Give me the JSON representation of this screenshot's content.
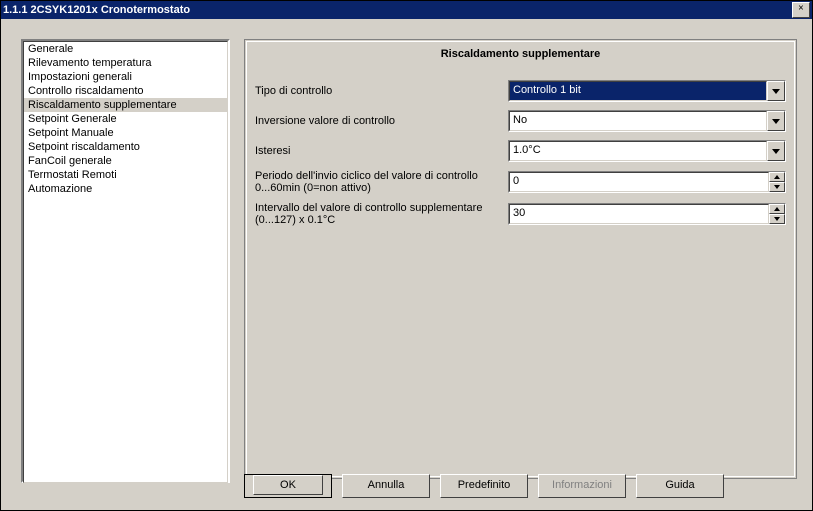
{
  "window": {
    "title": "1.1.1 2CSYK1201x Cronotermostato",
    "close": "×"
  },
  "sidebar": {
    "items": [
      {
        "label": "Generale"
      },
      {
        "label": "Rilevamento temperatura"
      },
      {
        "label": "Impostazioni generali"
      },
      {
        "label": "Controllo riscaldamento"
      },
      {
        "label": "Riscaldamento supplementare",
        "selected": true
      },
      {
        "label": "Setpoint Generale"
      },
      {
        "label": "Setpoint Manuale"
      },
      {
        "label": "Setpoint riscaldamento"
      },
      {
        "label": "FanCoil generale"
      },
      {
        "label": "Termostati Remoti"
      },
      {
        "label": "Automazione"
      }
    ]
  },
  "group": {
    "title": "Riscaldamento supplementare"
  },
  "params": [
    {
      "key": "controlType",
      "label": "Tipo di controllo",
      "kind": "combo",
      "value": "Controllo 1 bit",
      "highlighted": true
    },
    {
      "key": "invert",
      "label": "Inversione valore di controllo",
      "kind": "combo",
      "value": "No"
    },
    {
      "key": "hysteresis",
      "label": "Isteresi",
      "kind": "combo",
      "value": "1.0°C"
    },
    {
      "key": "cyclic",
      "label": "Periodo dell'invio ciclico del valore di controllo 0...60min (0=non attivo)",
      "kind": "spin",
      "value": "0"
    },
    {
      "key": "interval",
      "label": "Intervallo del valore di controllo supplementare (0...127) x 0.1°C",
      "kind": "spin",
      "value": "30"
    }
  ],
  "buttons": {
    "ok": "OK",
    "cancel": "Annulla",
    "default_": "Predefinito",
    "info": "Informazioni",
    "help": "Guida"
  }
}
